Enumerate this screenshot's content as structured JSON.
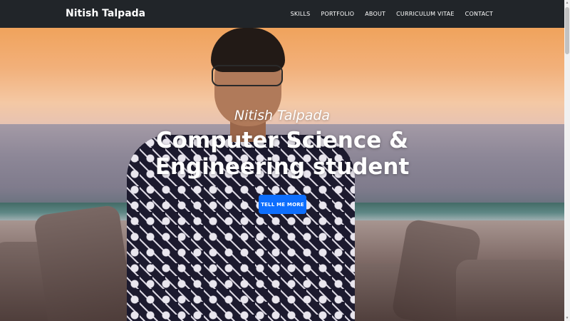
{
  "navbar": {
    "brand": "Nitish Talpada",
    "links": [
      "SKILLS",
      "PORTFOLIO",
      "ABOUT",
      "CURRICULUM VITAE",
      "CONTACT"
    ]
  },
  "hero": {
    "subtitle": "Nitish Talpada",
    "title": "Computer Science & Engineering student",
    "cta_label": "TELL ME MORE"
  },
  "colors": {
    "navbar_bg": "#212529",
    "accent": "#0d6efd",
    "text": "#ffffff"
  }
}
